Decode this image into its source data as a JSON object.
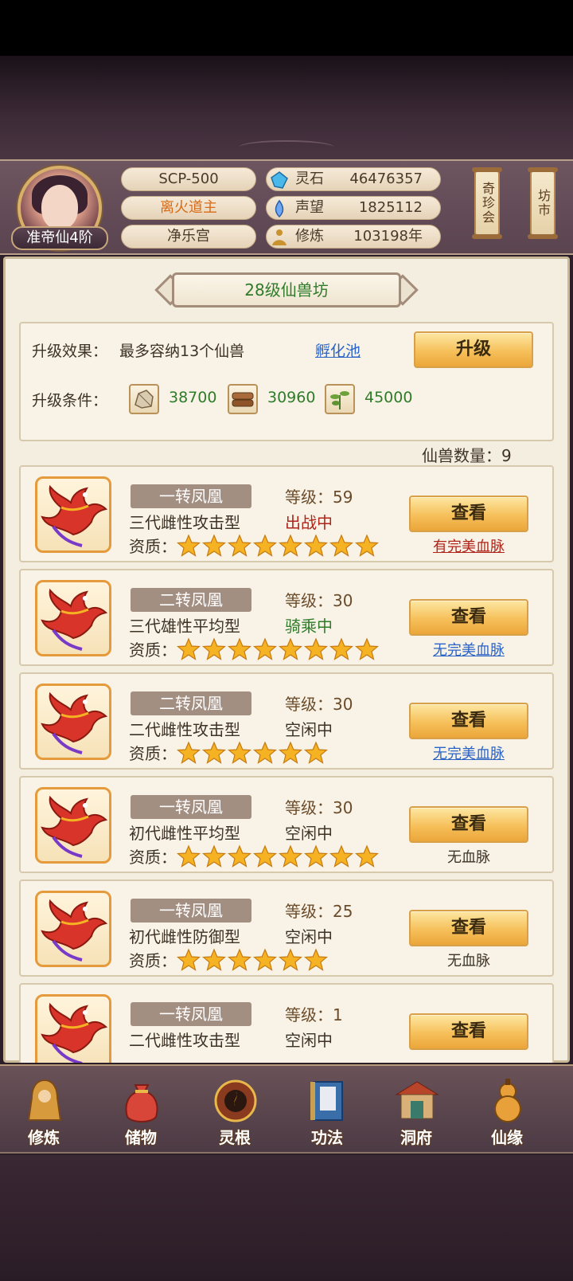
{
  "player": {
    "rank": "准帝仙4阶",
    "name": "SCP-500",
    "title": "离火道主",
    "sect": "净乐宫"
  },
  "stats": [
    {
      "icon": "spirit-stone-icon",
      "label": "灵石",
      "value": "46476357"
    },
    {
      "icon": "reputation-icon",
      "label": "声望",
      "value": "1825112"
    },
    {
      "icon": "cultivation-icon",
      "label": "修炼",
      "value": "103198年"
    }
  ],
  "side_buttons": {
    "treasure": "奇珍会",
    "market": "坊市"
  },
  "workshop": {
    "title": "28级仙兽坊",
    "effect_label": "升级效果：",
    "effect_text": "最多容纳13个仙兽",
    "hatch_link": "孵化池",
    "upgrade_button": "升级",
    "condition_label": "升级条件：",
    "materials": [
      {
        "icon": "ore-icon",
        "value": "38700"
      },
      {
        "icon": "wood-icon",
        "value": "30960"
      },
      {
        "icon": "herb-icon",
        "value": "45000"
      }
    ],
    "count_text": "仙兽数量：9"
  },
  "beast_labels": {
    "level_prefix": "等级：",
    "quality": "资质：",
    "view": "查看"
  },
  "beasts": [
    {
      "name": "一转凤凰",
      "type": "三代雌性攻击型",
      "level": "59",
      "status": "出战中",
      "status_color": "#b0241a",
      "stars": 8,
      "blood": "有完美血脉",
      "blood_kind": "red"
    },
    {
      "name": "二转凤凰",
      "type": "三代雄性平均型",
      "level": "30",
      "status": "骑乘中",
      "status_color": "#2f7b2a",
      "stars": 8,
      "blood": "无完美血脉",
      "blood_kind": "blue"
    },
    {
      "name": "二转凤凰",
      "type": "二代雌性攻击型",
      "level": "30",
      "status": "空闲中",
      "status_color": "#3d3224",
      "stars": 6,
      "blood": "无完美血脉",
      "blood_kind": "blue"
    },
    {
      "name": "一转凤凰",
      "type": "初代雌性平均型",
      "level": "30",
      "status": "空闲中",
      "status_color": "#3d3224",
      "stars": 8,
      "blood": "无血脉",
      "blood_kind": "none"
    },
    {
      "name": "一转凤凰",
      "type": "初代雌性防御型",
      "level": "25",
      "status": "空闲中",
      "status_color": "#3d3224",
      "stars": 6,
      "blood": "无血脉",
      "blood_kind": "none"
    },
    {
      "name": "一转凤凰",
      "type": "二代雌性攻击型",
      "level": "1",
      "status": "空闲中",
      "status_color": "#3d3224",
      "stars": 0,
      "blood": "",
      "blood_kind": "none"
    }
  ],
  "nav": [
    {
      "label": "修炼",
      "icon": "cultivate-icon"
    },
    {
      "label": "储物",
      "icon": "storage-bag-icon"
    },
    {
      "label": "灵根",
      "icon": "spirit-root-icon"
    },
    {
      "label": "功法",
      "icon": "technique-book-icon"
    },
    {
      "label": "洞府",
      "icon": "cave-house-icon"
    },
    {
      "label": "仙缘",
      "icon": "fate-gourd-icon"
    }
  ]
}
